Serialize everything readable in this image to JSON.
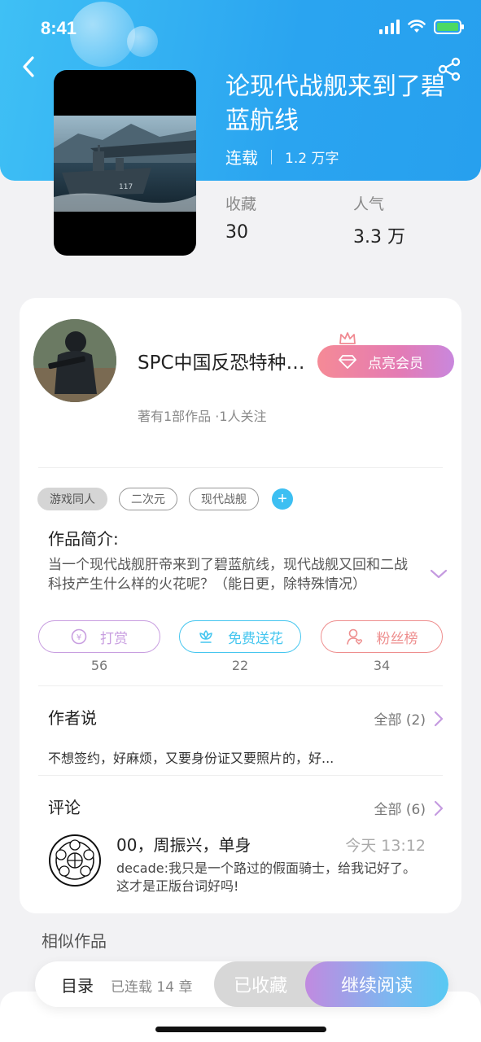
{
  "status_bar": {
    "time": "8:41"
  },
  "book": {
    "title": "论现代战舰来到了碧蓝航线",
    "status": "连载",
    "word_count": "1.2 万字",
    "stats": [
      {
        "label": "收藏",
        "value": "30"
      },
      {
        "label": "人气",
        "value": "3.3 万"
      }
    ]
  },
  "author": {
    "name": "SPC中国反恐特种部队...",
    "vip_label": "点亮会员",
    "subtitle": "著有1部作品 ·1人关注"
  },
  "tags": [
    "游戏同人",
    "二次元",
    "现代战舰"
  ],
  "intro": {
    "title": "作品简介:",
    "text": "当一个现代战舰肝帝来到了碧蓝航线，现代战舰又回和二战科技产生什么样的火花呢？（能日更，除特殊情况）"
  },
  "actions": [
    {
      "label": "打赏",
      "count": "56",
      "color": "#c89ee0",
      "icon": "yen-coin-icon"
    },
    {
      "label": "免费送花",
      "count": "22",
      "color": "#45c6ef",
      "icon": "flower-icon"
    },
    {
      "label": "粉丝榜",
      "count": "34",
      "color": "#ee8e8e",
      "icon": "fan-user-icon"
    }
  ],
  "author_says": {
    "title": "作者说",
    "more": "全部 (2)",
    "text": "不想签约，好麻烦，又要身份证又要照片的，好..."
  },
  "comments": {
    "title": "评论",
    "more": "全部 (6)",
    "items": [
      {
        "user": "00，周振兴，单身",
        "time": "今天 13:12",
        "text": "decade:我只是一个路过的假面骑士，给我记好了。这才是正版台词好吗!"
      }
    ]
  },
  "similar_title": "相似作品",
  "bottom_bar": {
    "toc": "目录",
    "chapters": "已连载 14 章",
    "collected": "已收藏",
    "read": "继续阅读"
  }
}
